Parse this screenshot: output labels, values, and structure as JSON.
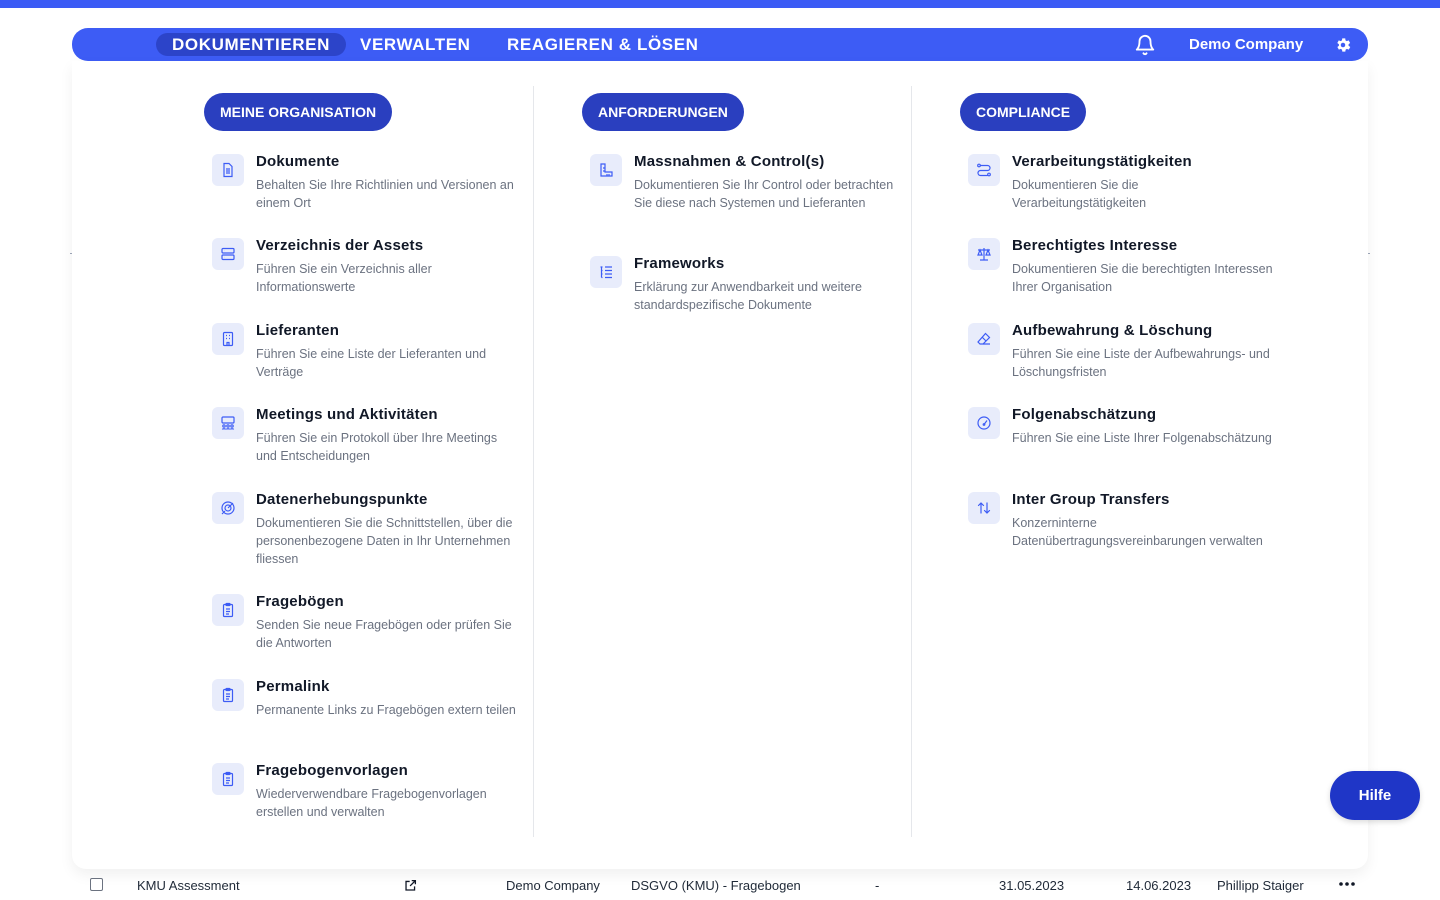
{
  "nav": {
    "tabs": [
      {
        "label": "DOKUMENTIEREN"
      },
      {
        "label": "VERWALTEN"
      },
      {
        "label": "REAGIEREN & LÖSEN"
      }
    ],
    "company": "Demo Company",
    "bell_icon": "bell-icon",
    "gear_icon": "gear-icon"
  },
  "columns": [
    {
      "heading": "MEINE ORGANISATION",
      "items": [
        {
          "title": "Dokumente",
          "desc": "Behalten Sie Ihre Richtlinien und Versionen an einem Ort",
          "icon": "document-icon"
        },
        {
          "title": "Verzeichnis der Assets",
          "desc": "Führen Sie ein Verzeichnis aller Informationswerte",
          "icon": "server-icon"
        },
        {
          "title": "Lieferanten",
          "desc": "Führen Sie eine Liste der Lieferanten und Verträge",
          "icon": "building-icon"
        },
        {
          "title": "Meetings und Aktivitäten",
          "desc": "Führen Sie ein Protokoll über Ihre Meetings und Entscheidungen",
          "icon": "meeting-icon"
        },
        {
          "title": "Datenerhebungspunkte",
          "desc": "Dokumentieren Sie die Schnittstellen, über die personenbezogene Daten in Ihr Unternehmen fliessen",
          "icon": "target-icon"
        },
        {
          "title": "Fragebögen",
          "desc": "Senden Sie neue Fragebögen oder prüfen Sie die Antworten",
          "icon": "clipboard-icon"
        },
        {
          "title": "Permalink",
          "desc": "Permanente Links zu Fragebögen extern teilen",
          "icon": "clipboard-icon"
        },
        {
          "title": "Fragebogenvorlagen",
          "desc": "Wiederverwendbare Fragebogenvorlagen erstellen und verwalten",
          "icon": "clipboard-icon"
        }
      ]
    },
    {
      "heading": "ANFORDERUNGEN",
      "items": [
        {
          "title": "Massnahmen & Control(s)",
          "desc": "Dokumentieren Sie Ihr Control oder betrachten Sie diese nach Systemen und Lieferanten",
          "icon": "ruler-icon"
        },
        {
          "title": "Frameworks",
          "desc": "Erklärung zur Anwendbarkeit und weitere standardspezifische Dokumente",
          "icon": "list-icon"
        }
      ]
    },
    {
      "heading": "COMPLIANCE",
      "items": [
        {
          "title": "Verarbeitungstätigkeiten",
          "desc": "Dokumentieren Sie die Verarbeitungstätigkeiten",
          "icon": "route-icon"
        },
        {
          "title": "Berechtigtes Interesse",
          "desc": "Dokumentieren Sie die berechtigten Interessen Ihrer Organisation",
          "icon": "scale-icon"
        },
        {
          "title": "Aufbewahrung & Löschung",
          "desc": "Führen Sie eine Liste der Aufbewahrungs- und Löschungsfristen",
          "icon": "eraser-icon"
        },
        {
          "title": "Folgenabschätzung",
          "desc": "Führen Sie eine Liste Ihrer Folgenabschätzung",
          "icon": "gauge-icon"
        },
        {
          "title": "Inter Group Transfers",
          "desc": "Konzerninterne Datenübertragungsvereinbarungen verwalten",
          "icon": "arrows-updown-icon"
        }
      ]
    }
  ],
  "help_button": "Hilfe",
  "table_row": {
    "name": "KMU Assessment",
    "company": "Demo Company",
    "template": "DSGVO (KMU) - Fragebogen",
    "dash": "-",
    "date1": "31.05.2023",
    "date2": "14.06.2023",
    "person": "Phillipp Staiger"
  },
  "colors": {
    "primary": "#3d5cf5",
    "pill": "#2a3fbf",
    "help": "#1f36c7"
  }
}
